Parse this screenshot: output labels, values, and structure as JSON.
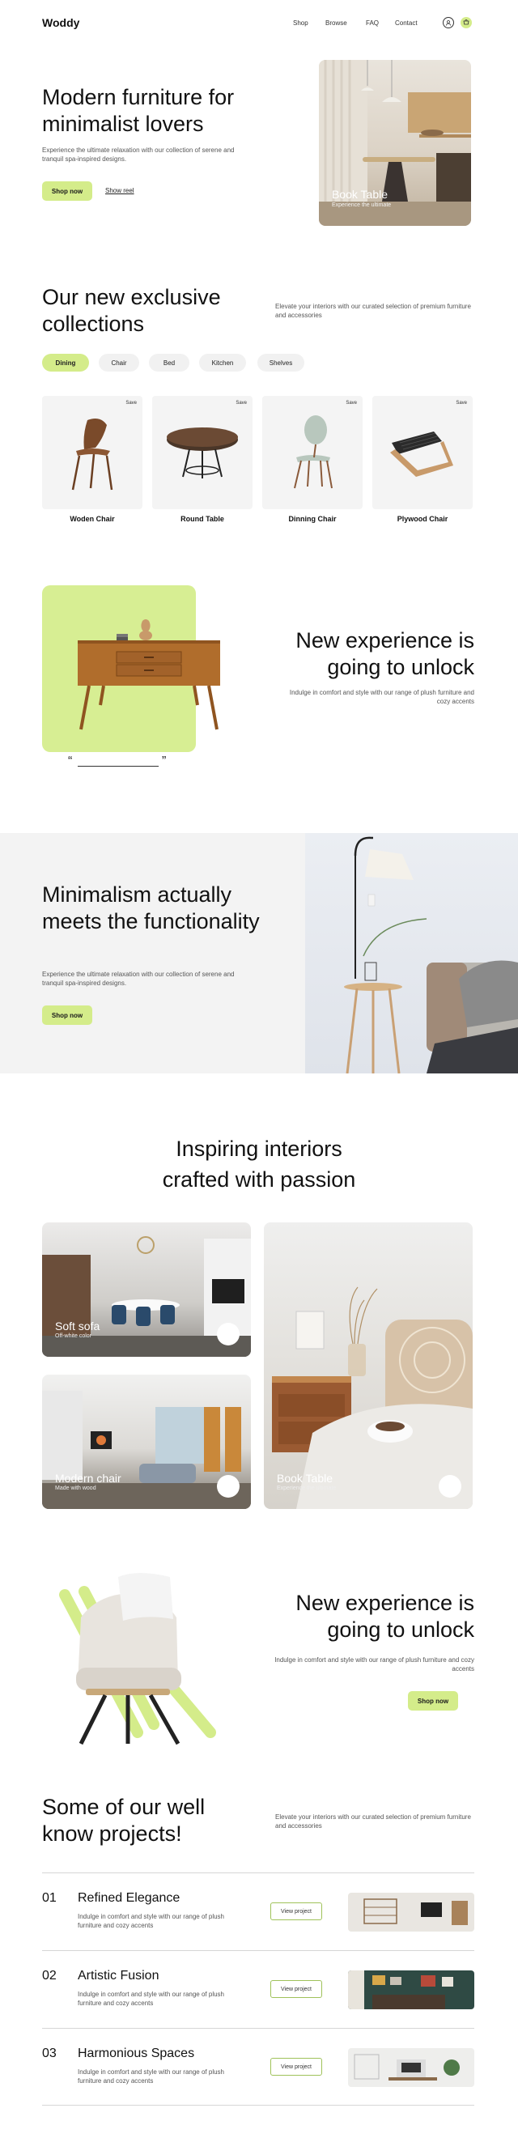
{
  "nav": {
    "logo": "Woddy",
    "links": [
      "Shop",
      "Browse",
      "FAQ",
      "Contact"
    ],
    "icons": [
      "user-icon",
      "cart-icon"
    ]
  },
  "hero": {
    "title": "Modern furniture for minimalist lovers",
    "desc": "Experience the ultimate relaxation with our collection of serene and tranquil spa-inspired designs.",
    "shop_label": "Shop now",
    "reel_label": "Show reel",
    "image_title": "Book Table",
    "image_sub": "Experience the ultimate"
  },
  "collections": {
    "title": "Our  new exclusive collections",
    "desc": "Elevate your interiors with our curated selection of premium furniture and accessories",
    "filters": [
      "Dining",
      "Chair",
      "Bed",
      "Kitchen",
      "Shelves"
    ],
    "active_filter": "Dining",
    "products": [
      {
        "name": "Woden Chair",
        "save": "Save"
      },
      {
        "name": "Round Table",
        "save": "Save"
      },
      {
        "name": "Dinning Chair",
        "save": "Save"
      },
      {
        "name": "Plywood Chair",
        "save": "Save"
      }
    ]
  },
  "experience1": {
    "title": "New experience is going to unlock",
    "desc": "Indulge in comfort and style with our range of plush furniture and cozy accents",
    "quote_open": "“",
    "quote_close": "”"
  },
  "minimalism": {
    "title": "Minimalism actually meets the functionality",
    "desc": "Experience the ultimate relaxation with our collection of serene and tranquil spa-inspired designs.",
    "shop_label": "Shop now"
  },
  "inspiring": {
    "title": "Inspiring interiors crafted with passion",
    "cards": [
      {
        "title": "Soft sofa",
        "sub": "Off-white color"
      },
      {
        "title": "Modern chair",
        "sub": "Made with wood"
      },
      {
        "title": "Book Table",
        "sub": "Experience the ultimate"
      }
    ]
  },
  "experience2": {
    "title": "New experience is going to unlock",
    "desc": "Indulge in comfort and style with our range of plush furniture and cozy accents",
    "shop_label": "Shop now"
  },
  "projects": {
    "title": "Some of our well know projects!",
    "desc": "Elevate your interiors with our curated selection of premium furniture and accessories",
    "view_label": "View project",
    "items": [
      {
        "num": "01",
        "title": "Refined Elegance",
        "desc": "Indulge in comfort and style with our range of plush furniture and cozy accents"
      },
      {
        "num": "02",
        "title": "Artistic Fusion",
        "desc": "Indulge in comfort and style with our range of plush furniture and cozy accents"
      },
      {
        "num": "03",
        "title": "Harmonious Spaces",
        "desc": "Indulge in comfort and style with our range of plush furniture and cozy accents"
      }
    ]
  },
  "colors": {
    "accent": "#d4ec8a",
    "grey_bg": "#f3f3f3"
  }
}
